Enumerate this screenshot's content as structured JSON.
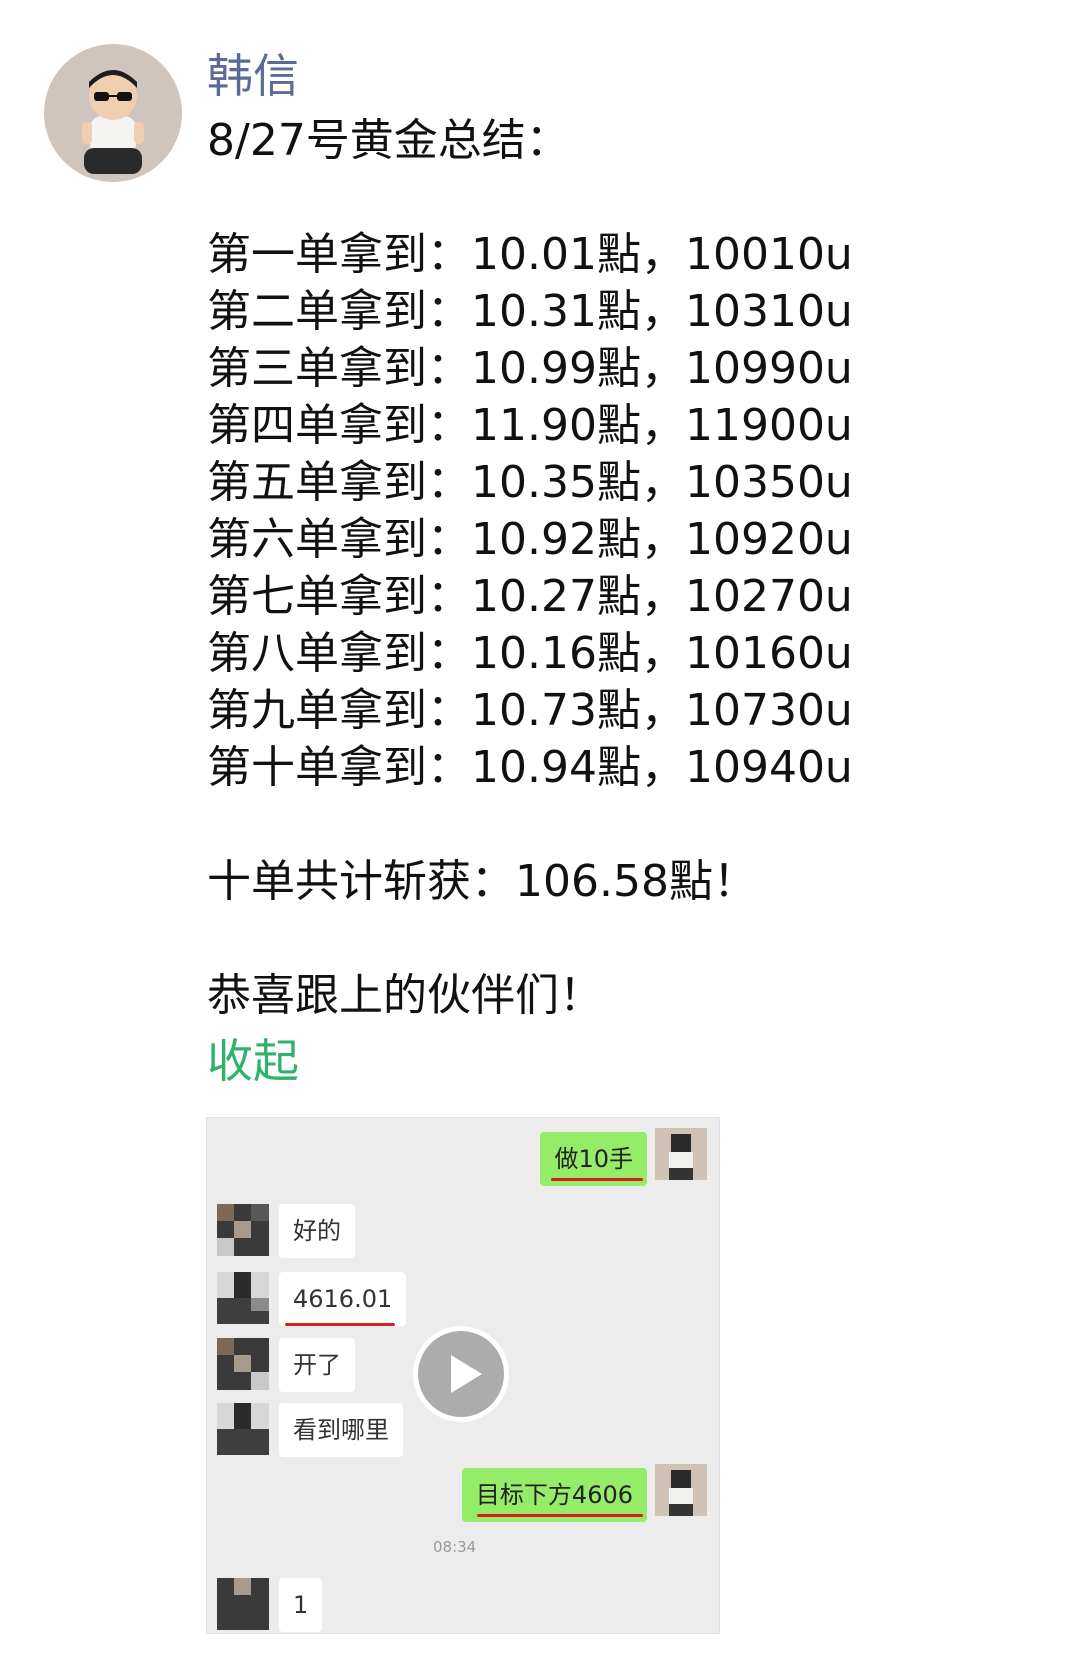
{
  "author": "韩信",
  "post": {
    "title": "8/27号黄金总结：",
    "lines": [
      "第一单拿到：10.01點，10010u",
      "第二单拿到：10.31點，10310u",
      "第三单拿到：10.99點，10990u",
      "第四单拿到：11.90點，11900u",
      "第五单拿到：10.35點，10350u",
      "第六单拿到：10.92點，10920u",
      "第七单拿到：10.27點，10270u",
      "第八单拿到：10.16點，10160u",
      "第九单拿到：10.73點，10730u",
      "第十单拿到：10.94點，10940u"
    ],
    "total": "十单共计斩获：106.58點！",
    "congrats": "恭喜跟上的伙伴们！"
  },
  "collapse_label": "收起",
  "video": {
    "messages": [
      {
        "side": "right",
        "text": "做10手"
      },
      {
        "side": "left",
        "text": "好的"
      },
      {
        "side": "left",
        "text": "4616.01"
      },
      {
        "side": "left",
        "text": "开了"
      },
      {
        "side": "left",
        "text": "看到哪里"
      },
      {
        "side": "right",
        "text": "目标下方4606"
      },
      {
        "side": "left",
        "text": "1"
      }
    ],
    "timestamp": "08:34",
    "play_icon": "play-icon",
    "colors": {
      "my_bubble": "#95ec69",
      "underline": "#d42020"
    }
  },
  "colors": {
    "author": "#5b6b95",
    "collapse": "#2fb36a"
  }
}
